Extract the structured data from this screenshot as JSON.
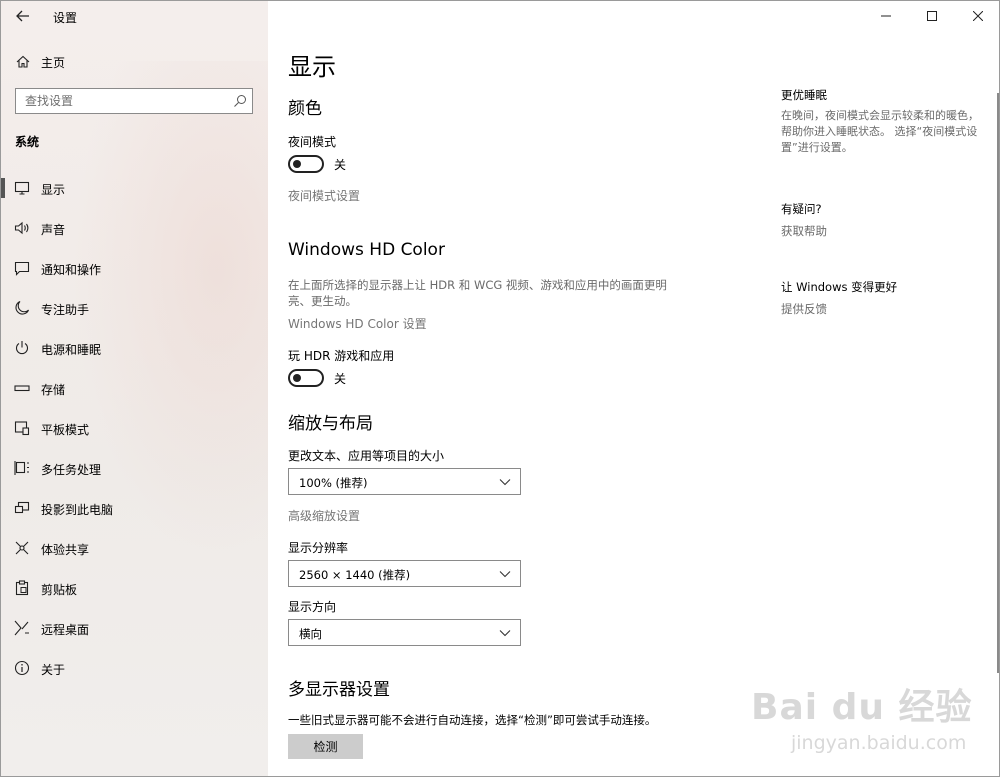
{
  "titlebar": {
    "title": "设置",
    "back_icon": "arrow-left-icon"
  },
  "window_controls": {
    "minimize_icon": "minimize-icon",
    "maximize_icon": "maximize-icon",
    "close_icon": "close-icon"
  },
  "sidebar": {
    "home_label": "主页",
    "search_placeholder": "查找设置",
    "group_title": "系统",
    "items": [
      {
        "label": "显示",
        "icon": "monitor-icon",
        "active": true
      },
      {
        "label": "声音",
        "icon": "speaker-icon"
      },
      {
        "label": "通知和操作",
        "icon": "notification-icon"
      },
      {
        "label": "专注助手",
        "icon": "moon-icon"
      },
      {
        "label": "电源和睡眠",
        "icon": "power-icon"
      },
      {
        "label": "存储",
        "icon": "storage-icon"
      },
      {
        "label": "平板模式",
        "icon": "tablet-icon"
      },
      {
        "label": "多任务处理",
        "icon": "multitask-icon"
      },
      {
        "label": "投影到此电脑",
        "icon": "project-icon"
      },
      {
        "label": "体验共享",
        "icon": "share-icon"
      },
      {
        "label": "剪贴板",
        "icon": "clipboard-icon"
      },
      {
        "label": "远程桌面",
        "icon": "remote-desktop-icon"
      },
      {
        "label": "关于",
        "icon": "info-icon"
      }
    ]
  },
  "main": {
    "page_title": "显示",
    "color": {
      "heading": "颜色",
      "night_mode_label": "夜间模式",
      "night_mode_state": "关",
      "night_mode_link": "夜间模式设置"
    },
    "hd_color": {
      "heading": "Windows HD Color",
      "description": "在上面所选择的显示器上让 HDR 和 WCG 视频、游戏和应用中的画面更明亮、更生动。",
      "link": "Windows HD Color 设置",
      "hdr_label": "玩 HDR 游戏和应用",
      "hdr_state": "关"
    },
    "scale_layout": {
      "heading": "缩放与布局",
      "scale_label": "更改文本、应用等项目的大小",
      "scale_value": "100% (推荐)",
      "advanced_link": "高级缩放设置",
      "resolution_label": "显示分辨率",
      "resolution_value": "2560 × 1440 (推荐)",
      "orientation_label": "显示方向",
      "orientation_value": "横向"
    },
    "multi_display": {
      "heading": "多显示器设置",
      "description": "一些旧式显示器可能不会进行自动连接，选择“检测”即可尝试手动连接。",
      "detect_button": "检测"
    }
  },
  "right_panel": {
    "sleep_heading": "更优睡眠",
    "sleep_text": "在晚间，夜间模式会显示较柔和的暖色，帮助你进入睡眠状态。 选择“夜间模式设置”进行设置。",
    "question_heading": "有疑问?",
    "help_link": "获取帮助",
    "improve_heading": "让 Windows 变得更好",
    "feedback_link": "提供反馈"
  },
  "watermark": {
    "main": "Bai du 经验",
    "sub": "jingyan.baidu.com"
  }
}
